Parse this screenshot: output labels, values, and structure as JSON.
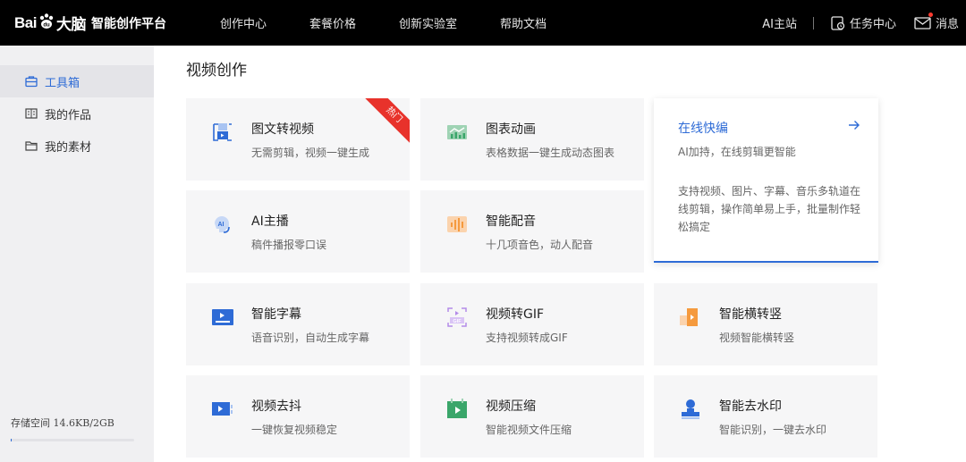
{
  "brand": {
    "logo_text_a": "Bai",
    "logo_text_b": "大脑",
    "name": "智能创作平台"
  },
  "nav": [
    "创作中心",
    "套餐价格",
    "创新实验室",
    "帮助文档"
  ],
  "right_nav": {
    "anchor": "AI主站",
    "tasks": "任务中心",
    "messages": "消息"
  },
  "sidebar": {
    "items": [
      {
        "label": "工具箱",
        "icon": "toolbox-icon",
        "active": true
      },
      {
        "label": "我的作品",
        "icon": "works-icon",
        "active": false
      },
      {
        "label": "我的素材",
        "icon": "folder-icon",
        "active": false
      }
    ],
    "storage_text": "存储空间 14.6KB/2GB",
    "storage_fraction": 6.8e-06
  },
  "main": {
    "title": "视频创作",
    "cards": [
      {
        "title": "图文转视频",
        "desc": "无需剪辑，视频一键生成",
        "icon": "image-to-video-icon",
        "badge": "热门"
      },
      {
        "title": "图表动画",
        "desc": "表格数据一键生成动态图表",
        "icon": "chart-animation-icon"
      },
      {
        "title": "AI主播",
        "desc": "稿件播报零口误",
        "icon": "ai-anchor-icon"
      },
      {
        "title": "智能配音",
        "desc": "十几项音色，动人配音",
        "icon": "voice-icon"
      },
      {
        "title": "智能字幕",
        "desc": "语音识别，自动生成字幕",
        "icon": "subtitle-icon"
      },
      {
        "title": "视频转GIF",
        "desc": "支持视频转成GIF",
        "icon": "gif-icon"
      },
      {
        "title": "智能横转竖",
        "desc": "视频智能横转竖",
        "icon": "rotate-icon"
      },
      {
        "title": "视频去抖",
        "desc": "一键恢复视频稳定",
        "icon": "stabilize-icon"
      },
      {
        "title": "视频压缩",
        "desc": "智能视频文件压缩",
        "icon": "compress-icon"
      },
      {
        "title": "智能去水印",
        "desc": "智能识别，一键去水印",
        "icon": "watermark-icon"
      }
    ],
    "feature": {
      "title": "在线快编",
      "subtitle": "AI加持，在线剪辑更智能",
      "desc": "支持视频、图片、字幕、音乐多轨道在线剪辑，操作简单易上手，批量制作轻松搞定"
    }
  },
  "colors": {
    "accent": "#2e6bd6",
    "topbar": "#000000",
    "hot": "#e8322b",
    "orange": "#f59a3e",
    "sidebar": "#f0f0f2"
  }
}
